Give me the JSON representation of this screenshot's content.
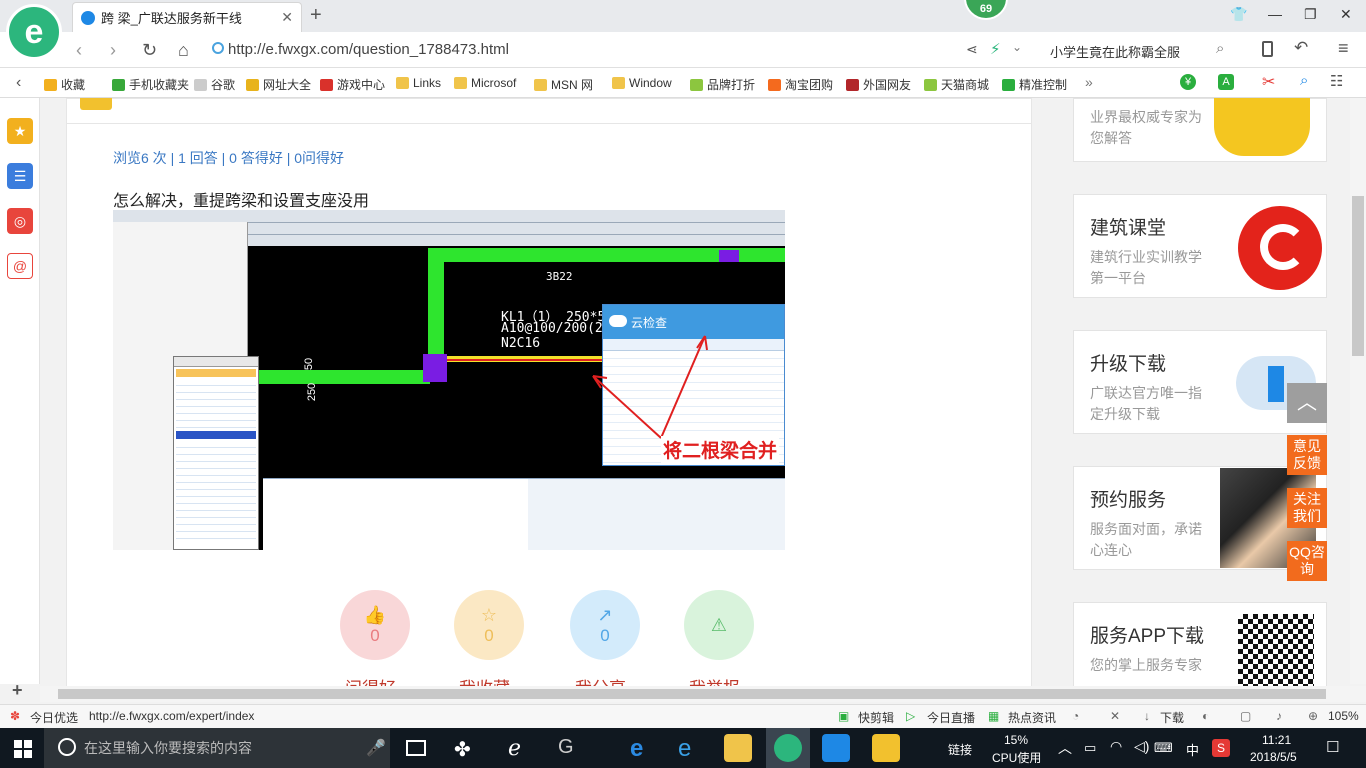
{
  "browser": {
    "tab_title": "跨 梁_广联达服务新干线",
    "notification_badge": "69",
    "url": "http://e.fwxgx.com/question_1788473.html",
    "url_host": "e.fwxgx.com",
    "search_box_text": "小学生竟在此称霸全服"
  },
  "bookmarks": [
    {
      "label": "收藏",
      "icon": "star-icon",
      "color": "#f2b01e"
    },
    {
      "label": "手机收藏夹",
      "icon": "phone-icon",
      "color": "#38a83a"
    },
    {
      "label": "谷歌",
      "icon": "page-icon",
      "color": "#cccccc"
    },
    {
      "label": "网址大全",
      "icon": "globe-icon",
      "color": "#e8b31c"
    },
    {
      "label": "游戏中心",
      "icon": "game-icon",
      "color": "#d9312b"
    },
    {
      "label": "Links",
      "icon": "folder-icon",
      "color": "#f0c44a"
    },
    {
      "label": "Microsof",
      "icon": "folder-icon",
      "color": "#f0c44a"
    },
    {
      "label": "MSN 网",
      "icon": "folder-icon",
      "color": "#f0c44a"
    },
    {
      "label": "Window",
      "icon": "folder-icon",
      "color": "#f0c44a"
    },
    {
      "label": "品牌打折",
      "icon": "leaf-icon",
      "color": "#8cc63f"
    },
    {
      "label": "淘宝团购",
      "icon": "taobao-icon",
      "color": "#f46a1e"
    },
    {
      "label": "外国网友",
      "icon": "bookmark-icon",
      "color": "#b2262a"
    },
    {
      "label": "天猫商城",
      "icon": "leaf-icon",
      "color": "#8cc63f"
    },
    {
      "label": "精准控制",
      "icon": "chat-icon",
      "color": "#2aae3e"
    }
  ],
  "question": {
    "stats": "浏览6 次 | 1 回答 | 0 答得好 | 0问得好",
    "text": "怎么解决，重提跨梁和设置支座没用",
    "screenshot": {
      "beam_label": "3B22",
      "beam_spec_1": "KL1（1） 250*5",
      "beam_spec_2": "A10@100/200(2)",
      "beam_spec_3": "N2C16",
      "dim_left": "250",
      "dim_mid": "50",
      "dialog_title": "云检查",
      "annotation": "将二根梁合并"
    }
  },
  "actions": [
    {
      "label": "问得好",
      "count": "0",
      "color": "#f9d7d8",
      "icon_color": "#e97c80",
      "icon": "thumbs-up-icon"
    },
    {
      "label": "我收藏",
      "count": "0",
      "color": "#fbe8c4",
      "icon_color": "#eebe5a",
      "icon": "star-icon"
    },
    {
      "label": "我分享",
      "count": "0",
      "color": "#d3ebfb",
      "icon_color": "#52a7e6",
      "icon": "share-icon"
    },
    {
      "label": "我举报",
      "count": "",
      "color": "#d9f3dc",
      "icon_color": "#58bb6a",
      "icon": "warning-icon"
    }
  ],
  "sidebar": {
    "cards": [
      {
        "title": "",
        "desc": "业界最权威专家为您解答"
      },
      {
        "title": "建筑课堂",
        "desc": "建筑行业实训教学第一平台"
      },
      {
        "title": "升级下载",
        "desc": "广联达官方唯一指定升级下载"
      },
      {
        "title": "预约服务",
        "desc": "服务面对面，承诺心连心"
      },
      {
        "title": "服务APP下载",
        "desc": "您的掌上服务专家"
      }
    ],
    "float_buttons": [
      "意见反馈",
      "关注我们",
      "QQ咨询"
    ]
  },
  "statusbar": {
    "left_label": "今日优选",
    "link_url": "http://e.fwxgx.com/expert/index",
    "items": [
      "快剪辑",
      "今日直播",
      "热点资讯",
      "下载"
    ],
    "zoom": "105%"
  },
  "taskbar": {
    "search_placeholder": "在这里输入你要搜索的内容",
    "network_label": "链接",
    "cpu_percent": "15%",
    "cpu_label": "CPU使用",
    "ime": "中",
    "time": "11:21",
    "date": "2018/5/5"
  }
}
